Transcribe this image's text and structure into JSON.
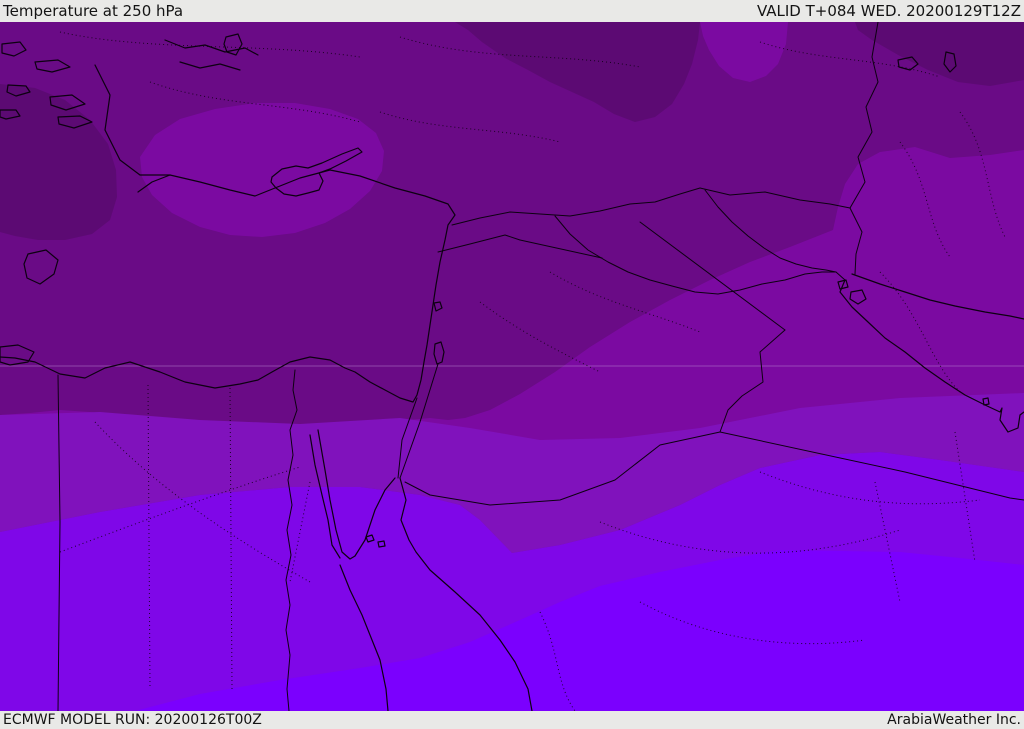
{
  "header": {
    "title": "Temperature at 250 hPa",
    "valid_label": "VALID T+084 WED. 20200129T12Z"
  },
  "footer": {
    "model_run_label": "ECMWF MODEL RUN: 20200126T00Z",
    "credit": "ArabiaWeather Inc."
  },
  "map": {
    "kind": "filled-contour-temperature-map",
    "level": "250 hPa",
    "region": "Eastern Mediterranean / Middle East",
    "line_color": "#0d0011",
    "grid_line_color": "#c9a2dd",
    "bands": [
      {
        "id": "band-1",
        "color": "#5c0a73"
      },
      {
        "id": "band-2",
        "color": "#6a0b86"
      },
      {
        "id": "band-3",
        "color": "#7b0aa1"
      },
      {
        "id": "band-4",
        "color": "#8012bc"
      },
      {
        "id": "band-5",
        "color": "#7f07e8"
      },
      {
        "id": "band-6",
        "color": "#7b00fe"
      }
    ]
  }
}
